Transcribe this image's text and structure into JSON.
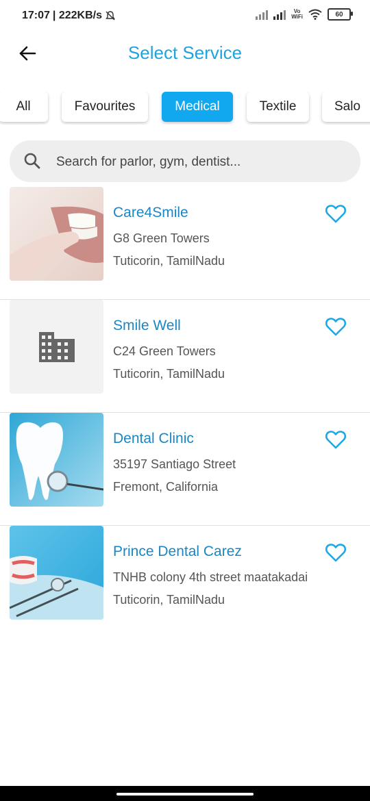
{
  "status_bar": {
    "time": "17:07",
    "network_speed": "| 222KB/s",
    "vowifi_top": "Vo",
    "vowifi_bottom": "WiFi",
    "battery": "60"
  },
  "header": {
    "title": "Select Service"
  },
  "filters": [
    "All",
    "Favourites",
    "Medical",
    "Textile",
    "Salo"
  ],
  "active_filter": "Medical",
  "search": {
    "placeholder": "Search for parlor, gym, dentist..."
  },
  "services": [
    {
      "name": "Care4Smile",
      "address": "G8 Green Towers",
      "city": "Tuticorin, TamilNadu",
      "thumb": "teeth-photo"
    },
    {
      "name": "Smile Well",
      "address": "C24 Green Towers",
      "city": "Tuticorin, TamilNadu",
      "thumb": "building-icon"
    },
    {
      "name": "Dental Clinic",
      "address": "35197 Santiago Street",
      "city": "Fremont, California",
      "thumb": "tooth-photo"
    },
    {
      "name": "Prince Dental Carez",
      "address": "TNHB colony 4th street maatakadai",
      "city": "Tuticorin, TamilNadu",
      "thumb": "dental-tools-photo"
    }
  ],
  "colors": {
    "accent": "#1fa3dd",
    "active_chip": "#12a8f0",
    "item_name": "#1a86c4",
    "heart": "#1ca7e8"
  }
}
